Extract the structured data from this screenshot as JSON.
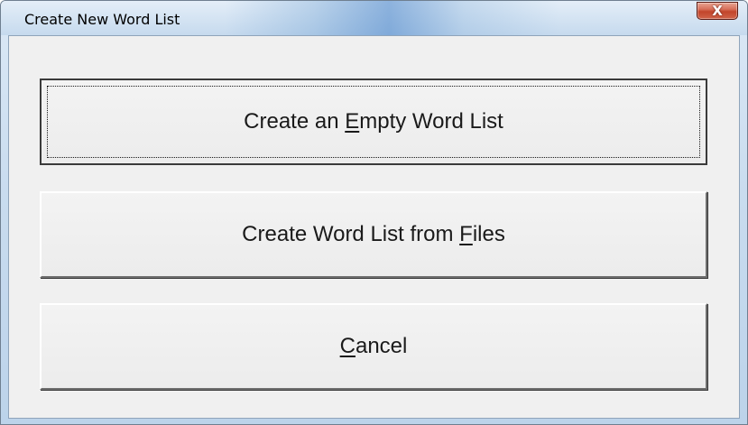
{
  "window": {
    "title": "Create New Word List",
    "close_glyph": "X"
  },
  "buttons": {
    "empty": {
      "before": "Create an ",
      "mnemonic": "E",
      "after": "mpty Word List"
    },
    "files": {
      "before": "Create Word List from ",
      "mnemonic": "F",
      "after": "iles"
    },
    "cancel": {
      "before": "",
      "mnemonic": "C",
      "after": "ancel"
    }
  },
  "icons": {
    "close": "close-icon"
  },
  "colors": {
    "close_button": "#c2452b",
    "client_background": "#f0f0f0",
    "titlebar": "#d2e2f2"
  }
}
